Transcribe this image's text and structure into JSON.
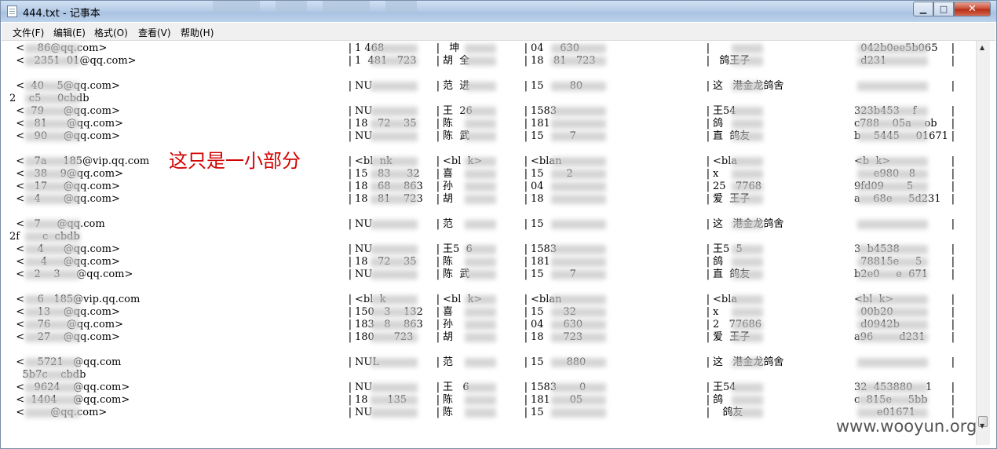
{
  "window": {
    "title": "444.txt - 记事本",
    "minimize_label": "▁",
    "maximize_label": "□",
    "close_label": "✕"
  },
  "menu": [
    "文件(F)",
    "编辑(E)",
    "格式(O)",
    "查看(V)",
    "帮助(H)"
  ],
  "annotation": "这只是一小部分",
  "watermark": "www.wooyun.org",
  "lines": [
    {
      "c1": "  <    86@qq.com>",
      "c2": "1 468",
      "c3": "  坤",
      "c4": "04     630",
      "c5": "",
      "c6": "  042b0ee5b065"
    },
    {
      "c1": "  <   2351  01@qq.com>",
      "c2": "1  481   723",
      "c3": "胡  全",
      "c4": "18   81   723",
      "c5": "  鸽王子",
      "c6": "  d231"
    },
    {
      "c1": "  <  40    5@qq.com>",
      "c2": "NU  ",
      "c3": "范  进",
      "c4": "15        80",
      "c5": "这   港金龙鸽舍",
      "c6": ""
    },
    {
      "c1": "2    c5     0cbdb",
      "c2": "",
      "c3": "",
      "c4": "",
      "c5": "",
      "c6": ""
    },
    {
      "c1": "  <  79      @qq.com>",
      "c2": "NU  ",
      "c3": "王  26",
      "c4": "1583     ",
      "c5": "王54 ",
      "c6": "323b453    f"
    },
    {
      "c1": "  <   81      @qq.com>",
      "c2": "18   72    35",
      "c3": "陈  ",
      "c4": "181      ",
      "c5": "鸽  ",
      "c6": "c788    05a    ob"
    },
    {
      "c1": "  <   90     @qq.com>",
      "c2": "NU  ",
      "c3": "陈  武",
      "c4": "15        7",
      "c5": "直  鸽友",
      "c6": "b    5445     01671"
    },
    {
      "c1": "  <   7a     185@vip.qq.com",
      "c2": "<bl  nk  ",
      "c3": "<bl  k>",
      "c4": "<blan  ",
      "c5": "<bla   ",
      "c6": "<b  k>"
    },
    {
      "c1": "  <   38    9@qq.com>",
      "c2": "15   83     32",
      "c3": "喜  ",
      "c4": "15       2",
      "c5": "x  ",
      "c6": "      e980   8"
    },
    {
      "c1": "  <   17     @qq.com>",
      "c2": "18   68    863",
      "c3": "孙  ",
      "c4": "04      ",
      "c5": "25   7768  ",
      "c6": "9fd09       5"
    },
    {
      "c1": "  <   4       @qq.com>",
      "c2": "18   81    723",
      "c3": "胡  ",
      "c4": "18       ",
      "c5": "爱  王子",
      "c6": "a    68e     5d231"
    },
    {
      "c1": "  <   7     @qq.com",
      "c2": "NU  ",
      "c3": "范  ",
      "c4": "15        ",
      "c5": "这   港金龙鸽舍",
      "c6": ""
    },
    {
      "c1": "2f       c  cbdb",
      "c2": "",
      "c3": "",
      "c4": "",
      "c5": "",
      "c6": ""
    },
    {
      "c1": "  <    4      @qq.com>",
      "c2": "NU  ",
      "c3": "王5  6",
      "c4": "1583      ",
      "c5": "王5  5",
      "c6": "3  b4538"
    },
    {
      "c1": "  <     4     @qq.com>",
      "c2": "18   72    35",
      "c3": "陈  ",
      "c4": "181      ",
      "c5": "鸽  ",
      "c6": "  78815e     5"
    },
    {
      "c1": "  <   2    3     @qq.com>",
      "c2": "NU  ",
      "c3": "陈  武",
      "c4": "15        7",
      "c5": "直  鸽友",
      "c6": "b2e0     e  671"
    },
    {
      "c1": "  <    6   185@vip.qq.com",
      "c2": "<bl  k  ",
      "c3": "<bl  k>",
      "c4": "<blan  ",
      "c5": "<bla  ",
      "c6": "<bl  k>"
    },
    {
      "c1": "  <    13    @qq.com>",
      "c2": "150   3    132",
      "c3": "喜  ",
      "c4": "15      32",
      "c5": "x  ",
      "c6": "  00b20    "
    },
    {
      "c1": "  <    76     @qq.com>",
      "c2": "183   8    863",
      "c3": "孙  ",
      "c4": "04      630",
      "c5": "2   77686",
      "c6": "  d0942b"
    },
    {
      "c1": "  <    27    @qq.com>",
      "c2": "180      723",
      "c3": "胡  ",
      "c4": "18      723",
      "c5": "爱  王子",
      "c6": "a96        d231"
    },
    {
      "c1": "  <    5721   @qq.com",
      "c2": "NUL  ",
      "c3": "范  ",
      "c4": "15       880",
      "c5": "这   港金龙鸽舍",
      "c6": ""
    },
    {
      "c1": "    5b7c    cbdb",
      "c2": "",
      "c3": "",
      "c4": "",
      "c5": "",
      "c6": ""
    },
    {
      "c1": "  <   9624    @qq.com>",
      "c2": "NU  ",
      "c3": "王   6",
      "c4": "1583       0",
      "c5": "王54 ",
      "c6": "32  453880    1"
    },
    {
      "c1": "  <  1404     @qq.com>",
      "c2": "18      135",
      "c3": "陈  ",
      "c4": "181      05",
      "c5": "鸽  ",
      "c6": "c  815e     5bb"
    },
    {
      "c1": "  <        @qq.com>",
      "c2": "NU  ",
      "c3": "陈  ",
      "c4": "15       ",
      "c5": "   鸽友",
      "c6": "       e01671"
    }
  ]
}
